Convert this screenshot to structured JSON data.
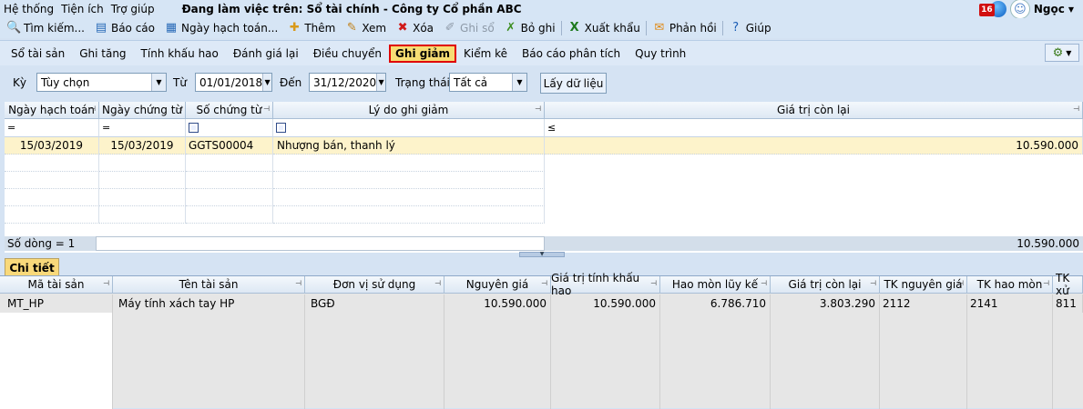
{
  "menu": {
    "items": [
      "Hệ thống",
      "Tiện ích",
      "Trợ giúp"
    ],
    "context": "Đang làm việc trên: Sổ tài chính - Công ty Cổ phần ABC",
    "notifications": "16",
    "user": "Ngọc"
  },
  "toolbar": {
    "search": "Tìm kiếm...",
    "report": "Báo cáo",
    "posting_date": "Ngày hạch toán...",
    "add": "Thêm",
    "view": "Xem",
    "delete": "Xóa",
    "post": "Ghi sổ",
    "unpost": "Bỏ ghi",
    "export": "Xuất khẩu",
    "feedback": "Phản hồi",
    "help": "Giúp"
  },
  "tabs": [
    "Sổ tài sản",
    "Ghi tăng",
    "Tính khấu hao",
    "Đánh giá lại",
    "Điều chuyển",
    "Ghi giảm",
    "Kiểm kê",
    "Báo cáo phân tích",
    "Quy trình"
  ],
  "filter": {
    "period_label": "Kỳ",
    "period_value": "Tùy chọn",
    "from_label": "Từ",
    "from_value": "01/01/2018",
    "to_label": "Đến",
    "to_value": "31/12/2020",
    "status_label": "Trạng thái",
    "status_value": "Tất cả",
    "fetch_button": "Lấy dữ liệu"
  },
  "main_grid": {
    "columns": [
      "Ngày hạch toán",
      "Ngày chứng từ",
      "Số chứng từ",
      "Lý do ghi giảm",
      "Giá trị còn lại"
    ],
    "filter_ops": [
      "=",
      "=",
      "",
      "",
      "≤"
    ],
    "rows": [
      [
        "15/03/2019",
        "15/03/2019",
        "GGTS00004",
        "Nhượng bán, thanh lý",
        "10.590.000"
      ]
    ],
    "footer_count": "Số dòng = 1",
    "footer_total": "10.590.000"
  },
  "detail": {
    "tab": "Chi tiết",
    "columns": [
      "Mã tài sản",
      "Tên tài sản",
      "Đơn vị sử dụng",
      "Nguyên giá",
      "Giá trị tính khấu hao",
      "Hao mòn lũy kế",
      "Giá trị còn lại",
      "TK nguyên giá",
      "TK hao mòn",
      "TK xử"
    ],
    "rows": [
      [
        "MT_HP",
        "Máy tính xách tay HP",
        "BGĐ",
        "10.590.000",
        "10.590.000",
        "6.786.710",
        "3.803.290",
        "2112",
        "2141",
        "811"
      ]
    ]
  }
}
